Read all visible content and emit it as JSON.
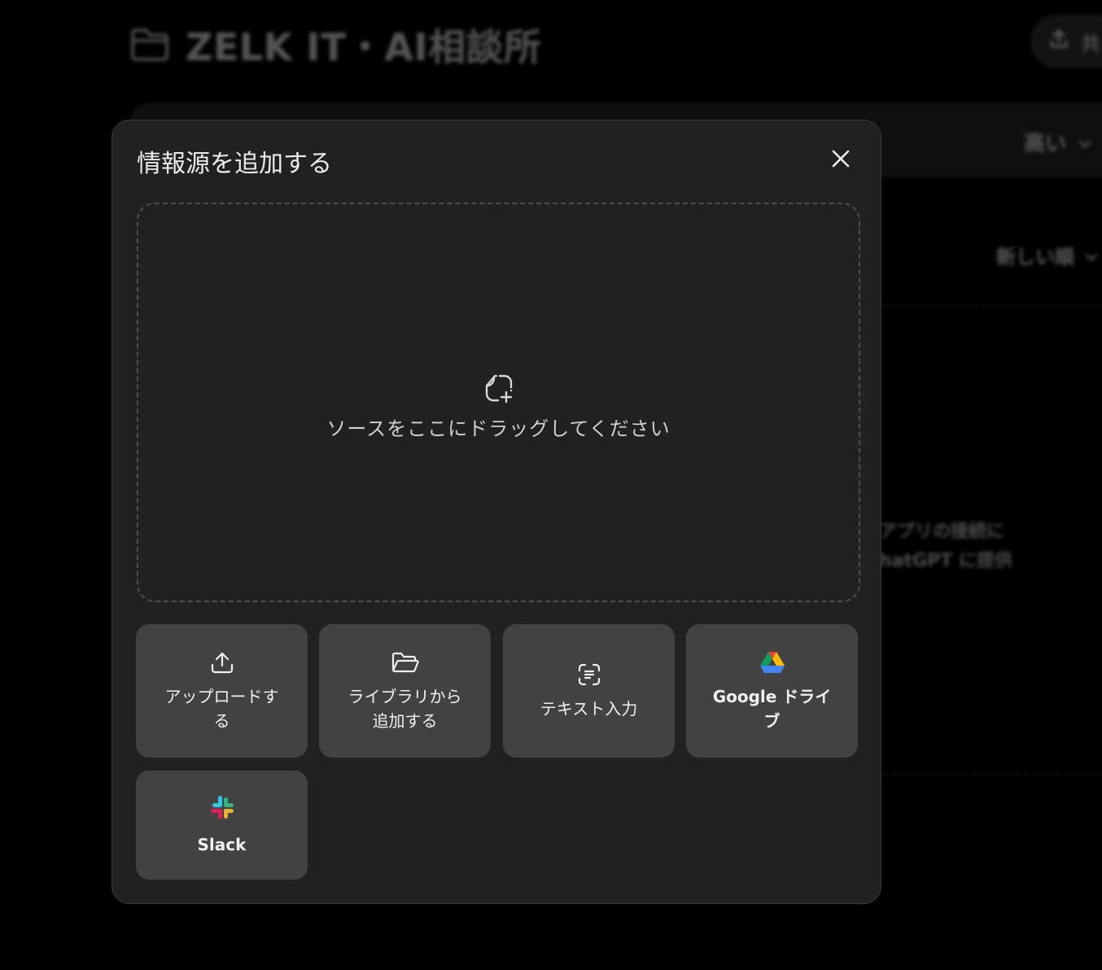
{
  "background": {
    "page_title": "ZELK IT・AI相談所",
    "share_label": "共",
    "quality_label": "高い",
    "sort_label": "新しい順",
    "text_line_1": "アプリの接続に",
    "text_line_2": "hatGPT に提供"
  },
  "modal": {
    "title": "情報源を追加する",
    "close_icon": "close-icon",
    "dropzone": {
      "icon": "add-file-icon",
      "text": "ソースをここにドラッグしてください"
    },
    "options": [
      {
        "icon": "upload-icon",
        "label_line_1": "アップロードす",
        "label_line_2": "る"
      },
      {
        "icon": "folder-open-icon",
        "label_line_1": "ライブラリから",
        "label_line_2": "追加する"
      },
      {
        "icon": "text-scan-icon",
        "label": "テキスト入力"
      },
      {
        "icon": "google-drive-icon",
        "label_line_1": "Google ドライ",
        "label_line_2": "ブ"
      },
      {
        "icon": "slack-icon",
        "label": "Slack"
      }
    ]
  }
}
